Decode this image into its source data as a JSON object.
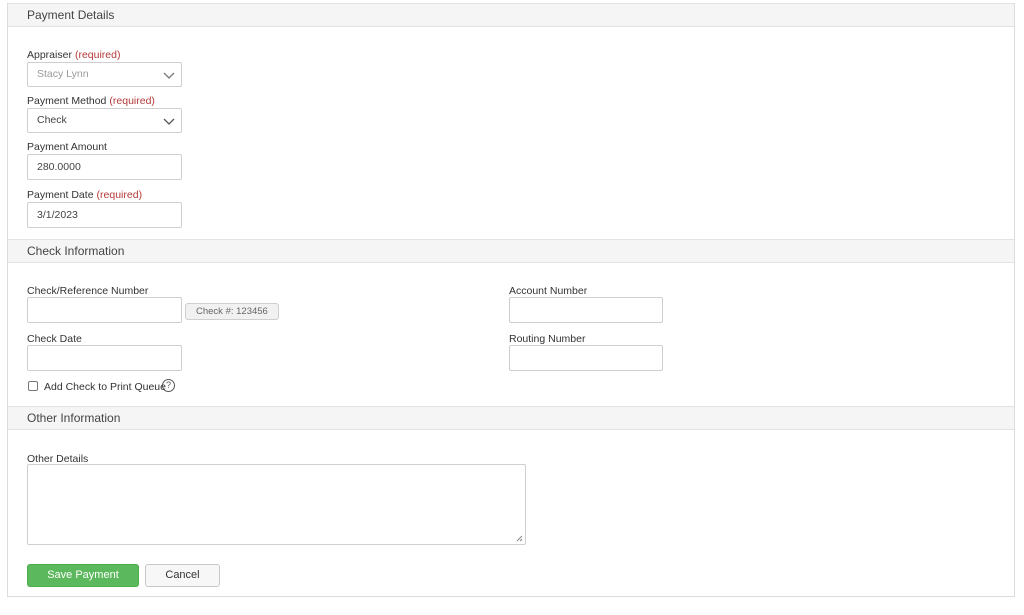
{
  "sections": {
    "payment_details": "Payment Details",
    "check_information": "Check Information",
    "other_information": "Other Information"
  },
  "appraiser": {
    "label": "Appraiser",
    "required": "(required)",
    "value": "Stacy Lynn"
  },
  "payment_method": {
    "label": "Payment Method",
    "required": "(required)",
    "value": "Check"
  },
  "payment_amount": {
    "label": "Payment Amount",
    "value": "280.0000"
  },
  "payment_date": {
    "label": "Payment Date",
    "required": "(required)",
    "value": "3/1/2023"
  },
  "check_reference": {
    "label": "Check/Reference Number",
    "value": "",
    "hint": "Check #: 123456"
  },
  "check_date": {
    "label": "Check Date",
    "value": ""
  },
  "account_number": {
    "label": "Account Number",
    "value": ""
  },
  "routing_number": {
    "label": "Routing Number",
    "value": ""
  },
  "print_queue": {
    "label": "Add Check to Print Queue",
    "checked": false,
    "help_icon": "question-circle-icon"
  },
  "other_details": {
    "label": "Other Details",
    "value": ""
  },
  "buttons": {
    "save": "Save Payment",
    "cancel": "Cancel"
  },
  "colors": {
    "primary": "#5cb85c",
    "required": "#b53a3a",
    "header_bg": "#f5f5f5"
  }
}
